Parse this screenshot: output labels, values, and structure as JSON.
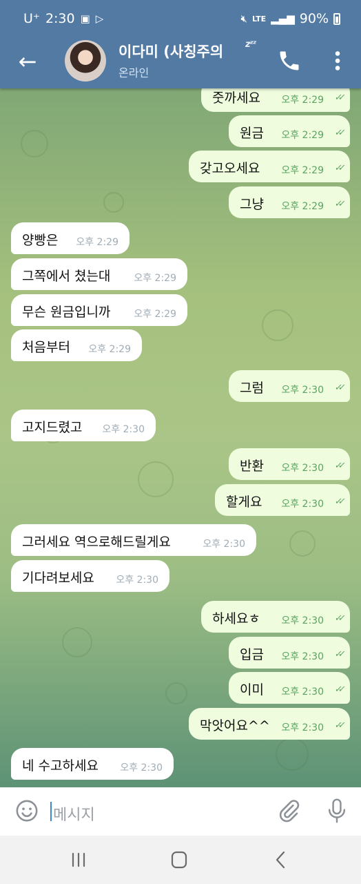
{
  "status_bar": {
    "carrier": "U⁺",
    "time": "2:30",
    "network": "LTE",
    "battery": "90%"
  },
  "header": {
    "contact_name": "이다미 (사칭주의",
    "contact_status": "온라인",
    "sleep_mark": "zᶻᶻ"
  },
  "messages": [
    {
      "direction": "out",
      "text": "줏까세요",
      "time": "오후 2:29"
    },
    {
      "direction": "out",
      "text": "원금",
      "time": "오후 2:29"
    },
    {
      "direction": "out",
      "text": "갖고오세요",
      "time": "오후 2:29"
    },
    {
      "direction": "out",
      "text": "그냥",
      "time": "오후 2:29"
    },
    {
      "direction": "in",
      "text": "양빵은",
      "time": "오후 2:29"
    },
    {
      "direction": "in",
      "text": "그쪽에서 쳤는대",
      "time": "오후 2:29"
    },
    {
      "direction": "in",
      "text": "무슨 원금입니까",
      "time": "오후 2:29"
    },
    {
      "direction": "in",
      "text": "처음부터",
      "time": "오후 2:29"
    },
    {
      "direction": "out",
      "text": "그럼",
      "time": "오후 2:30"
    },
    {
      "direction": "in",
      "text": "고지드렸고",
      "time": "오후 2:30"
    },
    {
      "direction": "out",
      "text": "반환",
      "time": "오후 2:30"
    },
    {
      "direction": "out",
      "text": "할게요",
      "time": "오후 2:30"
    },
    {
      "direction": "in",
      "text": "그러세요 역으로해드릴게요",
      "time": "오후 2:30"
    },
    {
      "direction": "in",
      "text": "기다려보세요",
      "time": "오후 2:30"
    },
    {
      "direction": "out",
      "text": "하세요ㅎ",
      "time": "오후 2:30"
    },
    {
      "direction": "out",
      "text": "입금",
      "time": "오후 2:30"
    },
    {
      "direction": "out",
      "text": "이미",
      "time": "오후 2:30"
    },
    {
      "direction": "out",
      "text": "막앗어요^^",
      "time": "오후 2:30"
    },
    {
      "direction": "in",
      "text": "네 수고하세요",
      "time": "오후 2:30"
    }
  ],
  "input": {
    "placeholder": "메시지"
  },
  "colors": {
    "header": "#527aa3",
    "outgoing_bubble": "#effdde",
    "incoming_bubble": "#ffffff",
    "read_check": "#5aa361"
  },
  "icons": [
    "back-arrow-icon",
    "phone-icon",
    "more-vert-icon",
    "emoji-icon",
    "attach-icon",
    "mic-icon"
  ]
}
